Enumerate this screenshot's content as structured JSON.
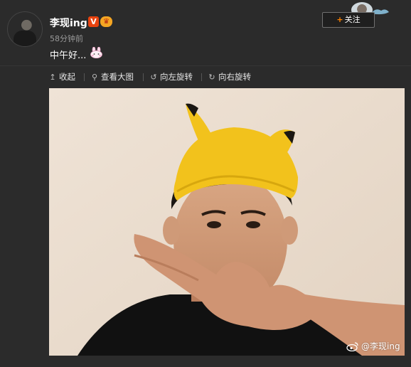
{
  "post": {
    "username": "李现ing",
    "badge_v": "V",
    "badge_crown": "♛",
    "timestamp": "58分钟前",
    "text": "中午好..."
  },
  "follow": {
    "plus": "+",
    "label": "关注"
  },
  "toolbar": {
    "collapse": {
      "icon": "↥",
      "label": "收起"
    },
    "view_large": {
      "icon": "⚲",
      "label": "查看大图"
    },
    "rotate_left": {
      "icon": "↺",
      "label": "向左旋转"
    },
    "rotate_right": {
      "icon": "↻",
      "label": "向右旋转"
    }
  },
  "photo": {
    "watermark": "@李现ing"
  },
  "colors": {
    "background": "#2b2b2b",
    "accent": "#ff8200",
    "badge_v": "#e8430f"
  }
}
